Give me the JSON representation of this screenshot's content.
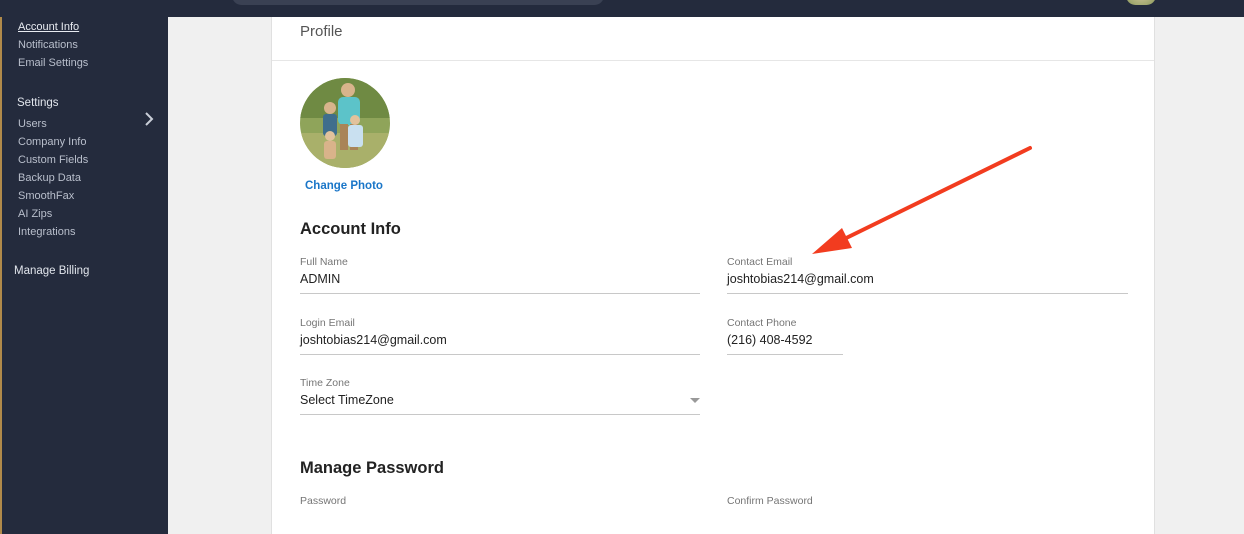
{
  "sidebar": {
    "account_links": [
      "Account Info",
      "Notifications",
      "Email Settings"
    ],
    "settings_label": "Settings",
    "settings_links": [
      "Users",
      "Company Info",
      "Custom Fields",
      "Backup Data",
      "SmoothFax",
      "AI Zips",
      "Integrations"
    ],
    "billing_label": "Manage Billing"
  },
  "profile": {
    "card_title": "Profile",
    "change_photo": "Change Photo"
  },
  "account_info": {
    "title": "Account Info",
    "full_name": {
      "label": "Full Name",
      "value": "ADMIN"
    },
    "contact_email": {
      "label": "Contact Email",
      "value": "joshtobias214@gmail.com"
    },
    "login_email": {
      "label": "Login Email",
      "value": "joshtobias214@gmail.com"
    },
    "contact_phone": {
      "label": "Contact Phone",
      "value": "(216) 408-4592"
    },
    "time_zone": {
      "label": "Time Zone",
      "value": "Select TimeZone"
    }
  },
  "manage_password": {
    "title": "Manage Password",
    "password_label": "Password",
    "confirm_password_label": "Confirm Password"
  },
  "colors": {
    "sidebar_bg": "#242b3d",
    "link_blue": "#1a76c8",
    "annotation_arrow": "#f23c1f"
  }
}
